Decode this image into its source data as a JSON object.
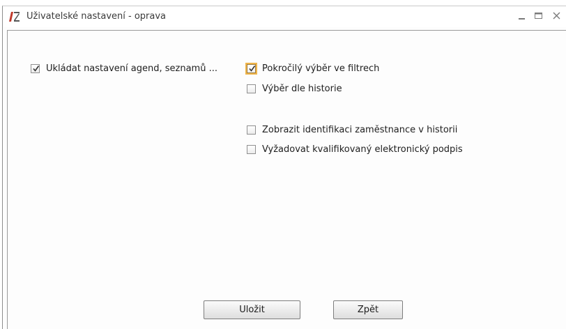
{
  "window": {
    "title": "Uživatelské nastavení - oprava",
    "controls": {
      "minimize": "minimize-icon",
      "maximize": "maximize-icon",
      "close": "close-icon"
    }
  },
  "checkboxes": {
    "save_settings": {
      "label": "Ukládat nastavení agend, seznamů ...",
      "checked": true
    },
    "advanced_filter": {
      "label": "Pokročilý výběr ve filtrech",
      "checked": true
    },
    "history_select": {
      "label": "Výběr dle historie",
      "checked": false
    },
    "show_employee_id": {
      "label": "Zobrazit identifikaci zaměstnance v historii",
      "checked": false
    },
    "qualified_signature": {
      "label": "Vyžadovat kvalifikovaný elektronický podpis",
      "checked": false
    }
  },
  "buttons": {
    "save": "Uložit",
    "back": "Zpět"
  },
  "colors": {
    "focus_ring": "#f0b54a",
    "logo_red": "#c0392b"
  }
}
